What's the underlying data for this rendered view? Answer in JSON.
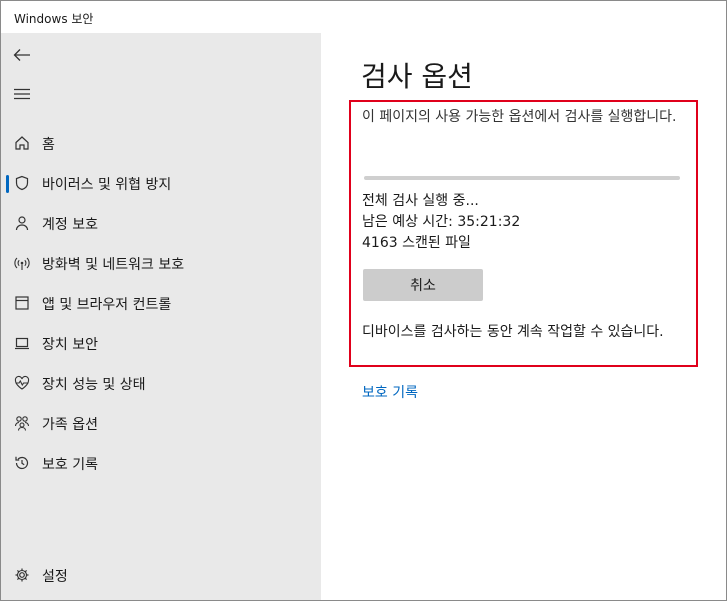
{
  "window": {
    "title": "Windows 보안"
  },
  "sidebar": {
    "back_icon": "back-arrow-icon",
    "menu_icon": "hamburger-menu-icon",
    "items": [
      {
        "label": "홈",
        "icon": "home-icon",
        "selected": false
      },
      {
        "label": "바이러스 및 위협 방지",
        "icon": "shield-icon",
        "selected": true
      },
      {
        "label": "계정 보호",
        "icon": "person-icon",
        "selected": false
      },
      {
        "label": "방화벽 및 네트워크 보호",
        "icon": "wireless-icon",
        "selected": false
      },
      {
        "label": "앱 및 브라우저 컨트롤",
        "icon": "app-window-icon",
        "selected": false
      },
      {
        "label": "장치 보안",
        "icon": "laptop-icon",
        "selected": false
      },
      {
        "label": "장치 성능 및 상태",
        "icon": "heart-pulse-icon",
        "selected": false
      },
      {
        "label": "가족 옵션",
        "icon": "family-icon",
        "selected": false
      },
      {
        "label": "보호 기록",
        "icon": "history-icon",
        "selected": false
      }
    ],
    "settings": {
      "label": "설정",
      "icon": "gear-icon"
    }
  },
  "main": {
    "title": "검사 옵션",
    "scan": {
      "description": "이 페이지의 사용 가능한 옵션에서 검사를 실행합니다.",
      "progress": 0,
      "status_line": "전체 검사 실행 중...",
      "time_remaining": "남은 예상 시간: 35:21:32",
      "files_scanned": "4163 스캔된 파일",
      "cancel_label": "취소",
      "note": "디바이스를 검사하는 동안 계속 작업할 수 있습니다."
    },
    "history_link": "보호 기록",
    "highlight_color": "#e0001b",
    "accent_color": "#0067c0"
  }
}
